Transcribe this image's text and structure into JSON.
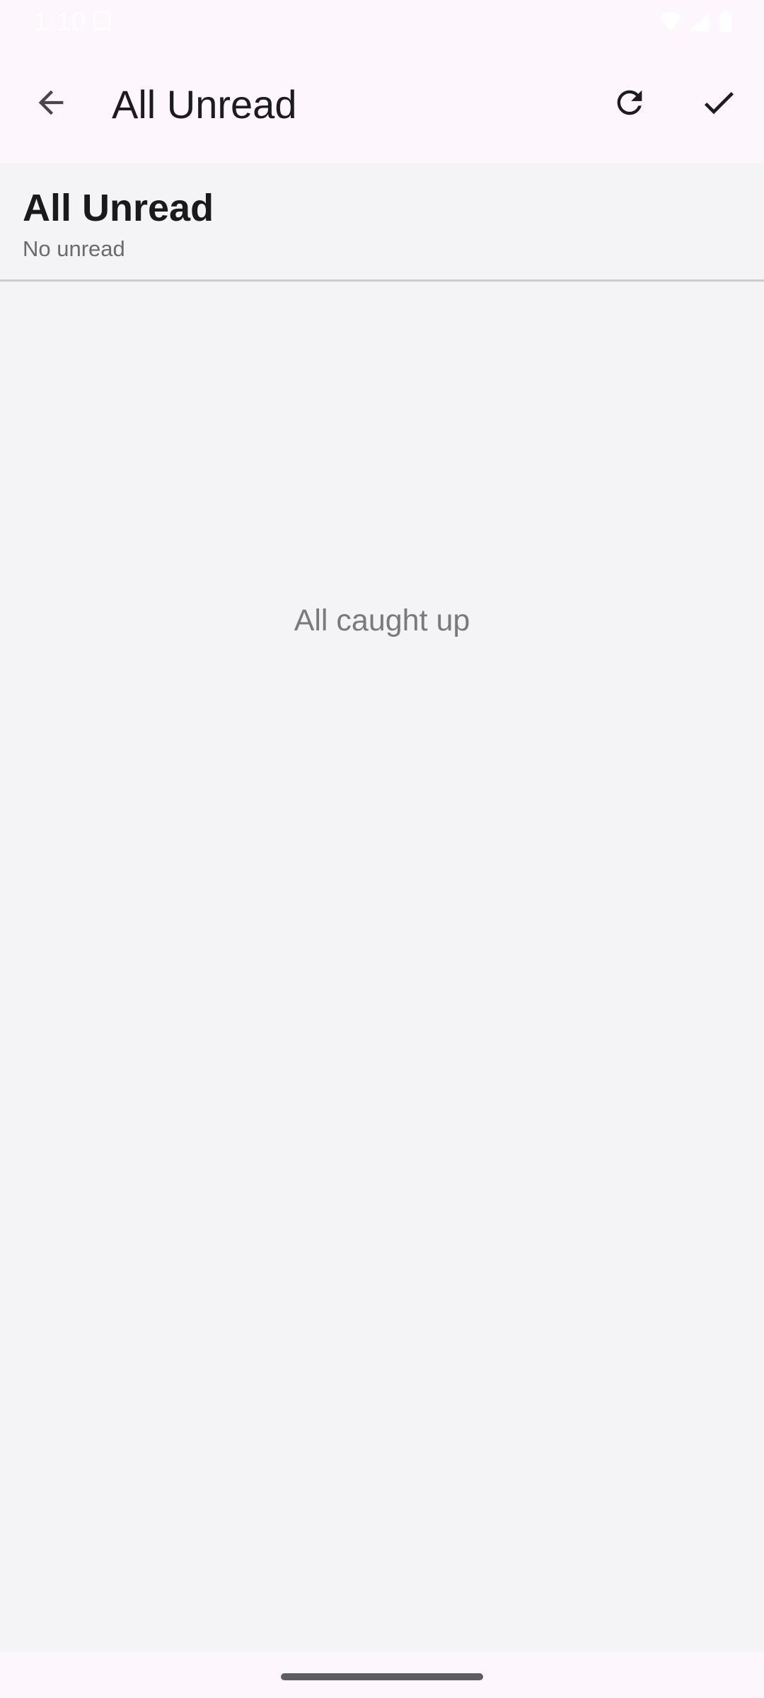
{
  "status_bar": {
    "time": "1:10",
    "icons": [
      "screen-notification-icon",
      "wifi-icon",
      "signal-icon",
      "battery-icon"
    ]
  },
  "app_bar": {
    "title": "All Unread",
    "back_icon": "arrow-back-icon",
    "actions": [
      "refresh-icon",
      "check-icon"
    ]
  },
  "header": {
    "title": "All Unread",
    "subtitle": "No unread"
  },
  "empty_state": {
    "message": "All caught up"
  },
  "colors": {
    "app_bar_background": "#fdf6fc",
    "content_background": "#f4f4f7",
    "primary_text": "#1d1b20",
    "secondary_text": "#7a7a7a"
  }
}
